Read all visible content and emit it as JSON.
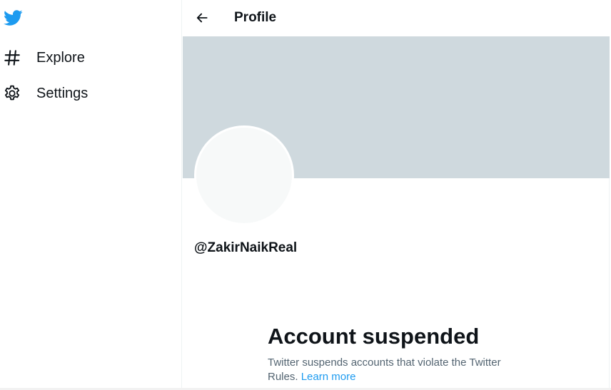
{
  "sidebar": {
    "logo_icon": "twitter-bird-icon",
    "items": [
      {
        "label": "Explore",
        "icon": "hashtag-icon"
      },
      {
        "label": "Settings",
        "icon": "gear-icon"
      }
    ]
  },
  "header": {
    "back_icon": "arrow-left-icon",
    "title": "Profile"
  },
  "profile": {
    "handle": "@ZakirNaikReal"
  },
  "suspended": {
    "title": "Account suspended",
    "text": "Twitter suspends accounts that violate the Twitter Rules.",
    "link": "Learn more"
  },
  "colors": {
    "brand": "#1d9bf0",
    "banner": "#cfd9de",
    "avatar": "#f7f9f9",
    "text_primary": "#0f1419",
    "text_secondary": "#536471"
  }
}
